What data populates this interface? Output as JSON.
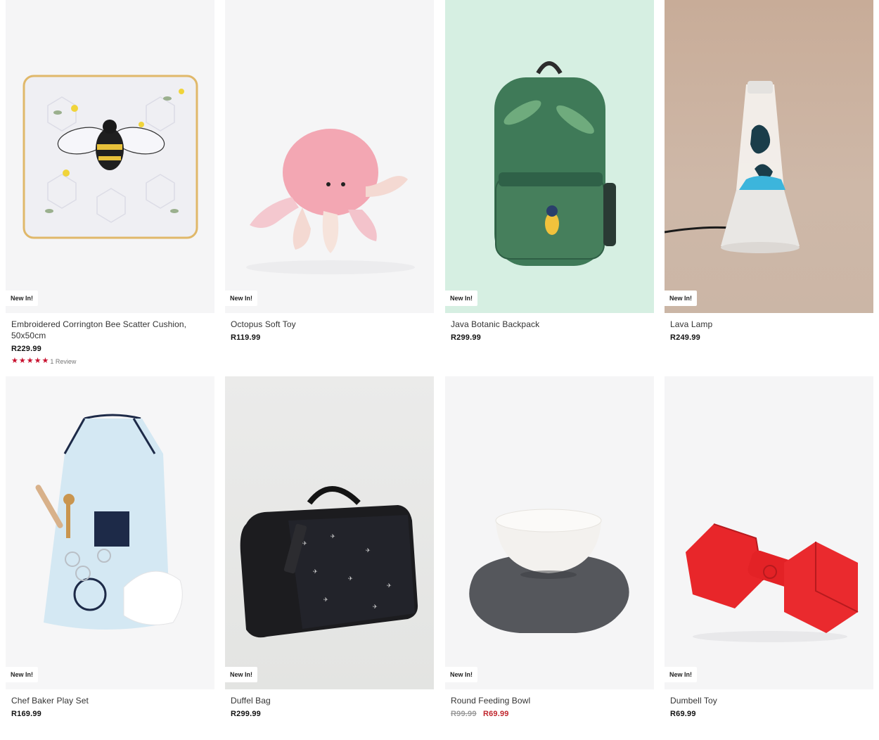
{
  "products": [
    {
      "title": "Embroidered Corrington Bee Scatter Cushion, 50x50cm",
      "price": "R229.99",
      "badge": "New In!",
      "image": "bee-cushion",
      "rating_stars": 5,
      "reviews": "1 Review"
    },
    {
      "title": "Octopus Soft Toy",
      "price": "R119.99",
      "badge": "New In!",
      "image": "octopus-toy"
    },
    {
      "title": "Java Botanic Backpack",
      "price": "R299.99",
      "badge": "New In!",
      "image": "botanic-backpack"
    },
    {
      "title": "Lava Lamp",
      "price": "R249.99",
      "badge": "New In!",
      "image": "lava-lamp"
    },
    {
      "title": "Chef Baker Play Set",
      "price": "R169.99",
      "badge": "New In!",
      "image": "chef-apron-set"
    },
    {
      "title": "Duffel Bag",
      "price": "R299.99",
      "badge": "New In!",
      "image": "duffel-bag"
    },
    {
      "title": "Round Feeding Bowl",
      "old_price": "R99.99",
      "sale_price": "R69.99",
      "badge": "New In!",
      "image": "feeding-bowl"
    },
    {
      "title": "Dumbell Toy",
      "price": "R69.99",
      "badge": "New In!",
      "image": "dumbbell-toy"
    }
  ],
  "colors": {
    "sale": "#c0262d",
    "star": "#c8102e",
    "backpack_bg": "#d6efe2",
    "lamp_bg": "#c9ad98"
  }
}
